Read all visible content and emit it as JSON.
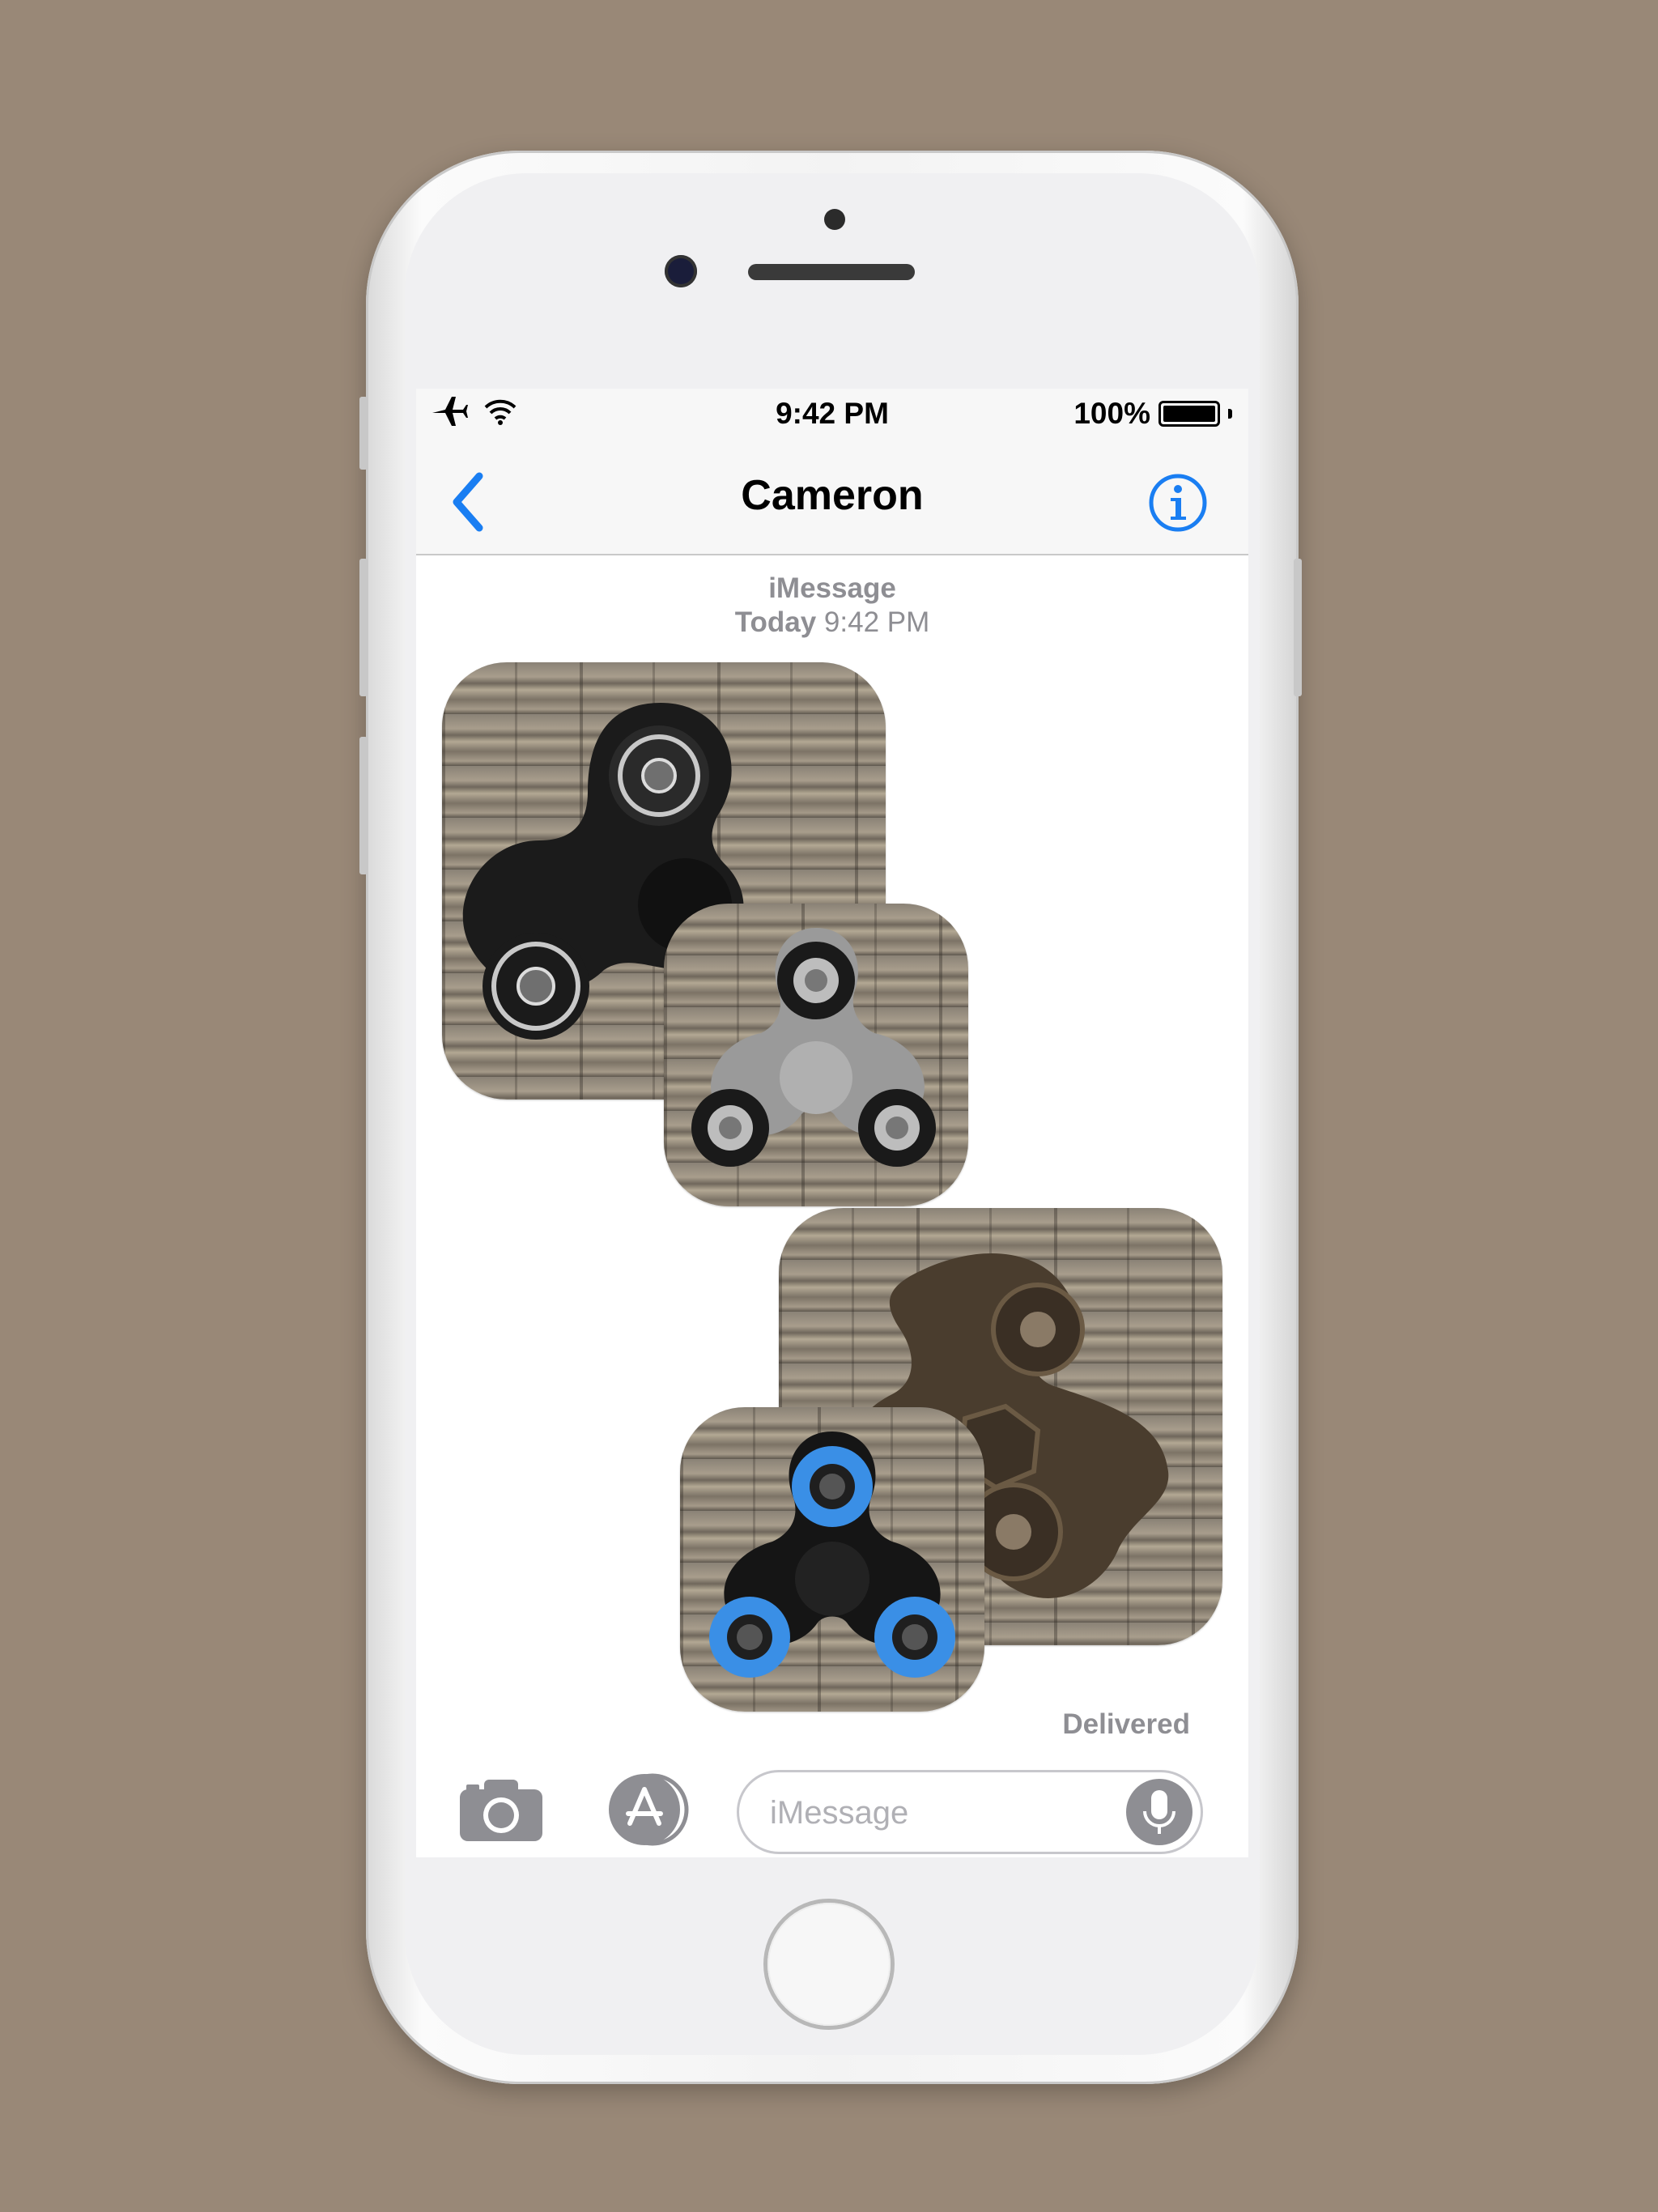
{
  "status_bar": {
    "time": "9:42 PM",
    "battery": "100%",
    "airplane_icon": "airplane-icon",
    "wifi_icon": "wifi-icon",
    "battery_level": 1.0
  },
  "nav": {
    "title": "Cameron",
    "back_icon": "chevron-left-icon",
    "info_icon": "info-icon",
    "accent": "#1a7ef2"
  },
  "thread": {
    "service": "iMessage",
    "day": "Today",
    "time": "9:42 PM",
    "delivered": "Delivered"
  },
  "stickers": [
    {
      "name": "black-fidget-spinner-sticker",
      "ring": "#c8c8c8",
      "body": "#1b1b1b"
    },
    {
      "name": "gray-fidget-spinner-sticker",
      "ring": "#1a1a1a",
      "body": "#9a9a9a"
    },
    {
      "name": "bronze-fidget-spinner-sticker",
      "ring": "#6b5a44",
      "body": "#4a3d2e"
    },
    {
      "name": "blue-fidget-spinner-sticker",
      "ring": "#3a8fe6",
      "body": "#151515"
    }
  ],
  "toolbar": {
    "placeholder": "iMessage",
    "camera_icon": "camera-icon",
    "appstore_icon": "app-store-icon",
    "mic_icon": "microphone-icon"
  }
}
